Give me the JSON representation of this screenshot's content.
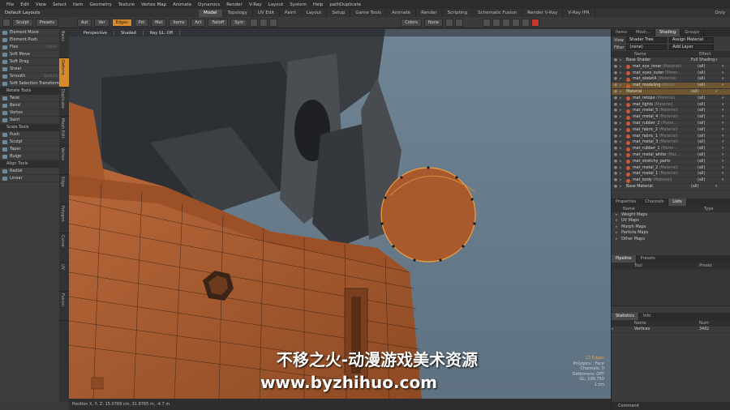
{
  "menubar": [
    "File",
    "Edit",
    "View",
    "Select",
    "Item",
    "Geometry",
    "Texture",
    "Vertex Map",
    "Animate",
    "Dynamics",
    "Render",
    "V-Ray",
    "Layout",
    "System",
    "Help",
    "pathDuplicate"
  ],
  "layout_selector": "Default Layouts",
  "mode_tabs": [
    "Model",
    "Topology",
    "UV Edit",
    "Paint",
    "Layout",
    "Setup",
    "Game Tools",
    "Animate",
    "Render",
    "Scripting",
    "Schematic Fusion",
    "Render V-Ray",
    "V-Ray IPR"
  ],
  "active_mode_tab": "Model",
  "user_label": "Only",
  "toolbar": {
    "sculpt": "Sculpt",
    "presets": "Presets",
    "auto": "Aut",
    "ver": "Ver",
    "edges": "Edges",
    "pol": "Pol",
    "mat": "Mat",
    "items": "Items",
    "action": "Act",
    "falloff": "Falloff",
    "sym": "Sym",
    "colors": "Colors",
    "none": "None"
  },
  "left_panel": {
    "items": [
      {
        "label": "Element Move",
        "short": ""
      },
      {
        "label": "Element Push",
        "short": ""
      },
      {
        "label": "Flex",
        "short": "Ctrl+F"
      },
      {
        "label": "Soft Move",
        "short": ""
      },
      {
        "label": "Soft Drag",
        "short": ""
      },
      {
        "label": "Shear",
        "short": ""
      },
      {
        "label": "Smooth",
        "short": "Shift+S"
      },
      {
        "label": "Soft Selection Transform",
        "short": ""
      }
    ],
    "rotate_head": "Rotate Tools",
    "rotate_items": [
      {
        "label": "Twist",
        "short": ""
      },
      {
        "label": "Bend",
        "short": ""
      },
      {
        "label": "Vortex",
        "short": ""
      },
      {
        "label": "Swirl",
        "short": ""
      }
    ],
    "scale_head": "Scale Tools",
    "scale_items": [
      {
        "label": "Push",
        "short": ""
      },
      {
        "label": "Sculpt",
        "short": ""
      },
      {
        "label": "Taper",
        "short": ""
      },
      {
        "label": "Bulge",
        "short": ""
      }
    ],
    "align_head": "Align Tools",
    "align_items": [
      {
        "label": "Radial",
        "short": ""
      },
      {
        "label": "Linear",
        "short": ""
      }
    ]
  },
  "vertical_tabs": [
    "Basic",
    "Deform",
    "Duplicate",
    "Mesh Edit",
    "Vertex",
    "Edge",
    "Polygon",
    "Curve",
    "UV",
    "Fusion"
  ],
  "active_vertical_tab": "Deform",
  "viewport": {
    "header": [
      "Perspective",
      "Shaded",
      "Ray GL: Off"
    ],
    "info": {
      "selection": "12 Edges",
      "lines": [
        "Polygons : Face",
        "Channels: 0",
        "Deformers: OFF",
        "GL: 199,750",
        "1 cm"
      ]
    }
  },
  "statusbar": "Position X, Y, Z:   15.0769 cm, 31.8765 m, -4.7 m",
  "watermark": {
    "line1": "不移之火-动漫游戏美术资源",
    "line2": "www.byzhihuo.com"
  },
  "right_panel": {
    "top_tabs": [
      "Items",
      "Mesh...",
      "Shading",
      "Groups"
    ],
    "active_top_tab": "Shading",
    "view_label": "View",
    "view_value": "Shader Tree",
    "assign_label": "Assign Material",
    "filter_label": "Filter",
    "filter_value": "(none)",
    "add_layer": "Add Layer",
    "shader_header": {
      "name": "Name",
      "effect": "Effect"
    },
    "shader_rows": [
      {
        "name": "Base Shader",
        "sub": "",
        "effect": "Full Shading",
        "dot": false,
        "sel": false
      },
      {
        "name": "mat_eye_inner",
        "sub": "(Material)",
        "effect": "(all)",
        "dot": true,
        "sel": false
      },
      {
        "name": "mat_eyes_outer",
        "sub": "(Mater...",
        "effect": "(all)",
        "dot": true,
        "sel": false
      },
      {
        "name": "mat_skeletA",
        "sub": "(Material)",
        "effect": "(all)",
        "dot": true,
        "sel": false
      },
      {
        "name": "mat_modeling",
        "sub": "(Mater...",
        "effect": "(all)",
        "dot": true,
        "sel": true
      },
      {
        "name": "Material",
        "sub": "",
        "effect": "(all)",
        "dot": false,
        "sel": true
      },
      {
        "name": "mat_retopo",
        "sub": "(Material)",
        "effect": "(all)",
        "dot": true,
        "sel": false
      },
      {
        "name": "mat_lights",
        "sub": "(Material)",
        "effect": "(all)",
        "dot": true,
        "sel": false
      },
      {
        "name": "mat_metal_5",
        "sub": "(Material)",
        "effect": "(all)",
        "dot": true,
        "sel": false
      },
      {
        "name": "mat_metal_4",
        "sub": "(Material)",
        "effect": "(all)",
        "dot": true,
        "sel": false
      },
      {
        "name": "mat_rubber_2",
        "sub": "(Mater...",
        "effect": "(all)",
        "dot": true,
        "sel": false
      },
      {
        "name": "mat_fabric_2",
        "sub": "(Material)",
        "effect": "(all)",
        "dot": true,
        "sel": false
      },
      {
        "name": "mat_fabric_1",
        "sub": "(Material)",
        "effect": "(all)",
        "dot": true,
        "sel": false
      },
      {
        "name": "mat_metal_3",
        "sub": "(Material)",
        "effect": "(all)",
        "dot": true,
        "sel": false
      },
      {
        "name": "mat_rubber_1",
        "sub": "(Mater...",
        "effect": "(all)",
        "dot": true,
        "sel": false
      },
      {
        "name": "mat_metal_white",
        "sub": "(Mat...",
        "effect": "(all)",
        "dot": true,
        "sel": false
      },
      {
        "name": "mat_stretchy_parts",
        "sub": "",
        "effect": "(all)",
        "dot": true,
        "sel": false
      },
      {
        "name": "mat_metal_2",
        "sub": "(Material)",
        "effect": "(all)",
        "dot": true,
        "sel": false
      },
      {
        "name": "mat_metal_1",
        "sub": "(Material)",
        "effect": "(all)",
        "dot": true,
        "sel": false
      },
      {
        "name": "mat_body",
        "sub": "(Material)",
        "effect": "(all)",
        "dot": true,
        "sel": false
      },
      {
        "name": "Base Material",
        "sub": "",
        "effect": "(all)",
        "dot": false,
        "sel": false
      }
    ],
    "mid_tabs": [
      "Properties",
      "Channels",
      "Lists"
    ],
    "active_mid_tab": "Lists",
    "lists_header": {
      "name": "Name",
      "type": "Type"
    },
    "lists_rows": [
      "Weight Maps",
      "UV Maps",
      "Morph Maps",
      "Particle Maps",
      "Other Maps"
    ],
    "pipeline_tabs": [
      "Pipeline",
      "Presets"
    ],
    "pipeline_header": {
      "name": "Tool",
      "preset": "Preset"
    },
    "stats_tabs": [
      "Statistics",
      "Info"
    ],
    "stats_header": {
      "name": "Name",
      "num": "Num"
    },
    "stats_rows": [
      {
        "name": "Vertices",
        "num": "3482"
      }
    ],
    "command_label": "Command"
  },
  "colors": {
    "accent": "#d68a2b",
    "model_orange": "#b0602f",
    "viewport_bg": "#6a7f8f",
    "record_red": "#c0392b"
  }
}
